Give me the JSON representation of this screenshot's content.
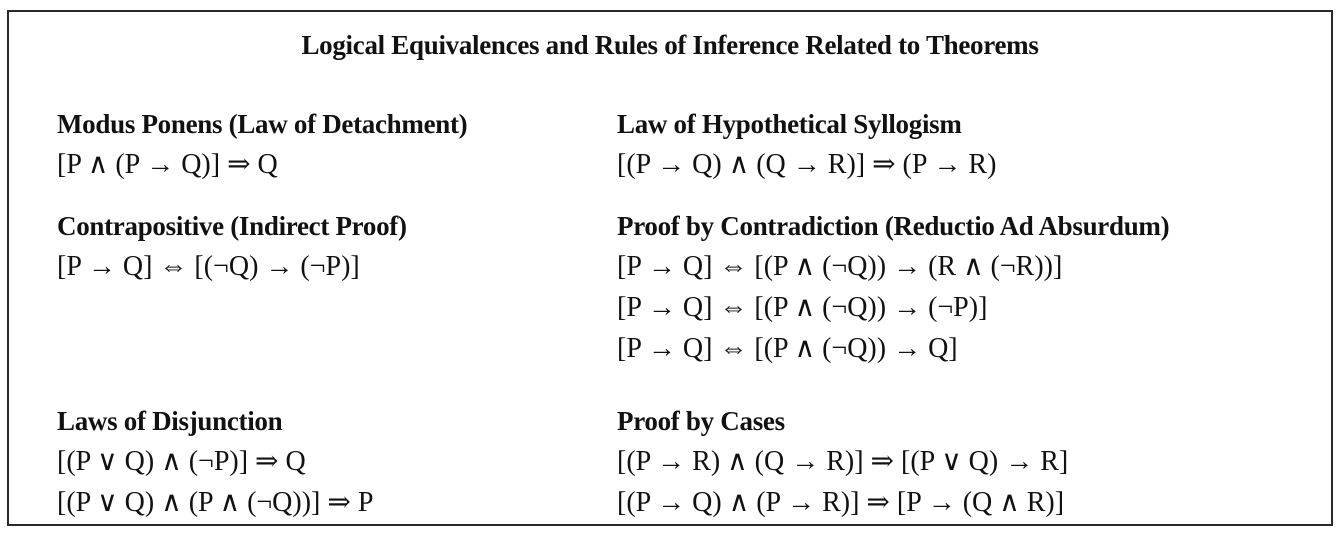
{
  "title": "Logical Equivalences and Rules of Inference Related to Theorems",
  "sections": {
    "modus_ponens": {
      "heading": "Modus Ponens (Law of Detachment)",
      "formulas": [
        "[P ∧ (P → Q)] ⇒ Q"
      ]
    },
    "hypothetical_syllogism": {
      "heading": "Law of Hypothetical Syllogism",
      "formulas": [
        "[(P → Q) ∧ (Q → R)] ⇒ (P → R)"
      ]
    },
    "contrapositive": {
      "heading": "Contrapositive (Indirect Proof)",
      "formulas": [
        "[P → Q] ⇔ [(¬Q) → (¬P)]"
      ]
    },
    "contradiction": {
      "heading": "Proof by Contradiction (Reductio Ad Absurdum)",
      "formulas": [
        "[P → Q] ⇔ [(P ∧ (¬Q)) → (R ∧ (¬R))]",
        "[P → Q] ⇔ [(P ∧ (¬Q)) → (¬P)]",
        "[P → Q] ⇔ [(P ∧ (¬Q)) → Q]"
      ]
    },
    "disjunction": {
      "heading": "Laws of Disjunction",
      "formulas": [
        "[(P ∨ Q) ∧ (¬P)] ⇒ Q",
        "[(P ∨ Q) ∧ (P ∧ (¬Q))] ⇒ P"
      ]
    },
    "cases": {
      "heading": "Proof by Cases",
      "formulas": [
        "[(P → R) ∧ (Q → R)] ⇒ [(P ∨ Q) → R]",
        "[(P → Q) ∧ (P → R)] ⇒ [P → (Q ∧ R)]"
      ]
    }
  }
}
